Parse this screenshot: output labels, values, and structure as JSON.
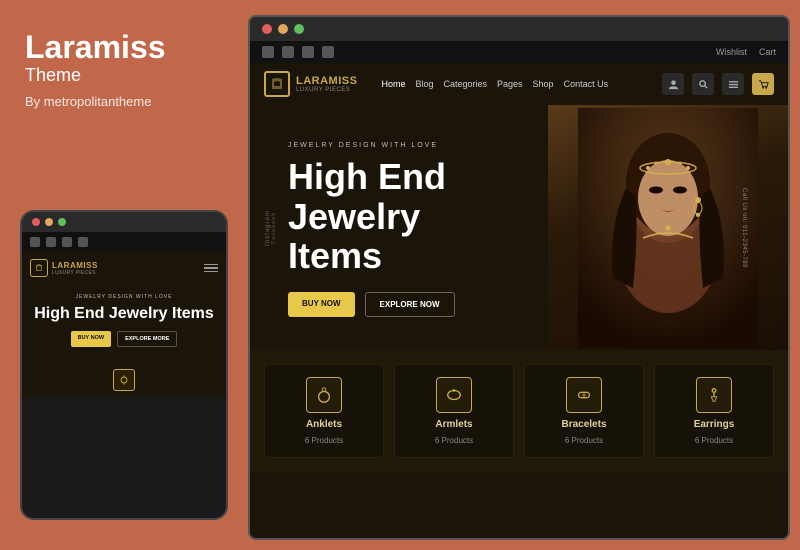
{
  "brand": {
    "title": "Laramiss",
    "subtitle": "Theme",
    "author": "By metropolitantheme"
  },
  "mobile": {
    "hero_subtitle": "JEWELRY DESIGN WITH LOVE",
    "hero_title": "High End Jewelry Items",
    "btn_primary": "BUY NOW",
    "btn_secondary": "EXPLORE MORE",
    "logo_text": "LARAMISS",
    "logo_sub": "LUXURY PIECES"
  },
  "desktop": {
    "social_links": [
      "f",
      "t",
      "p",
      "in"
    ],
    "top_links": [
      "Wishlist",
      "Cart"
    ],
    "logo_text": "LARAMISS",
    "logo_sub": "LUXURY PIECES",
    "nav_links": [
      "Home",
      "Blog",
      "Categories",
      "Pages",
      "Shop",
      "Contact Us"
    ],
    "hero_subtitle": "JEWELRY DESIGN WITH LOVE",
    "hero_title": "High End\nJewelry\nItems",
    "btn_primary": "BUY NOW",
    "btn_secondary": "EXPLORE NOW",
    "side_label_right": "Call Us on: 011-2345-789"
  },
  "categories": [
    {
      "name": "Anklets",
      "count": "6 Products",
      "icon": "anklet"
    },
    {
      "name": "Armlets",
      "count": "6 Products",
      "icon": "armlet"
    },
    {
      "name": "Bracelets",
      "count": "6 Products",
      "icon": "bracelet"
    },
    {
      "name": "Earrings",
      "count": "6 Products",
      "icon": "earring"
    }
  ]
}
